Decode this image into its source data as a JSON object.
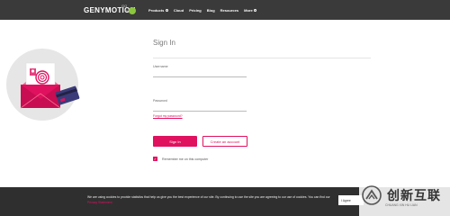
{
  "header": {
    "logo": "GENYMOTION",
    "logo_sup": "GO",
    "by": "by",
    "nav": [
      {
        "label": "Products",
        "has_dropdown": true
      },
      {
        "label": "Cloud",
        "has_dropdown": false
      },
      {
        "label": "Pricing",
        "has_dropdown": false
      },
      {
        "label": "Blog",
        "has_dropdown": false
      },
      {
        "label": "Resources",
        "has_dropdown": false
      },
      {
        "label": "More",
        "has_dropdown": true
      }
    ]
  },
  "signin": {
    "title": "Sign In",
    "username_label": "Username",
    "username_value": "",
    "password_label": "Password",
    "password_value": "",
    "forgot_link": "Forgot my password?",
    "signin_button": "Sign In",
    "create_button": "Create an account",
    "remember_label": "Remember me on this computer",
    "remember_checked": true
  },
  "cookie": {
    "text": "We are using cookies to provide statistics that help us give you the best experience of our site. By continuing to use the site you are agreeing to our use of cookies. You can find our",
    "link": "Privacy Statement",
    "button": "I Agree"
  },
  "watermark": {
    "title": "创新互联",
    "subtitle": "CHUANG XIN HU LIAN"
  },
  "colors": {
    "brand": "#e0115f",
    "topbar": "#3a3a3a",
    "cookie_bar": "#2f2f2f",
    "badge": "#8cc63f"
  }
}
